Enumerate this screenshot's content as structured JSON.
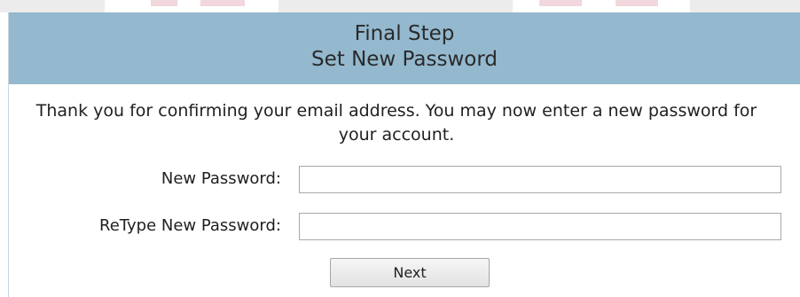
{
  "header": {
    "line1": "Final Step",
    "line2": "Set New Password"
  },
  "intro_text": "Thank you for confirming your email address. You may now enter a new password for your account.",
  "form": {
    "new_password": {
      "label": "New Password:",
      "value": ""
    },
    "retype_password": {
      "label": "ReType New Password:",
      "value": ""
    },
    "next_label": "Next"
  },
  "colors": {
    "header_bg": "#94b9cf",
    "page_bg": "#ffffff"
  }
}
